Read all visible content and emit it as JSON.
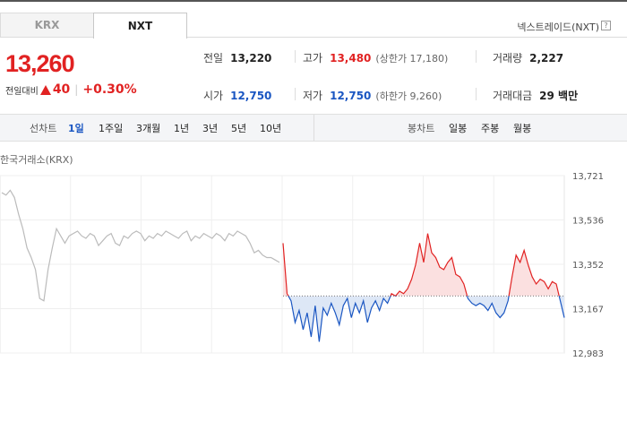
{
  "tabs": [
    {
      "label": "KRX",
      "active": false
    },
    {
      "label": "NXT",
      "active": true
    }
  ],
  "exchange_label": "넥스트레이드(NXT)",
  "help_icon": "?",
  "price": {
    "current": "13,260",
    "change_label": "전일대비",
    "change_value": "40",
    "change_percent": "+0.30%",
    "direction": "up"
  },
  "stats": {
    "prev_close": {
      "label": "전일",
      "value": "13,220"
    },
    "high": {
      "label": "고가",
      "value": "13,480",
      "note": "(상한가 17,180)"
    },
    "volume": {
      "label": "거래량",
      "value": "2,227"
    },
    "open": {
      "label": "시가",
      "value": "12,750"
    },
    "low": {
      "label": "저가",
      "value": "12,750",
      "note": "(하한가 9,260)"
    },
    "trade_value": {
      "label": "거래대금",
      "value": "29 백만"
    }
  },
  "period_bar": {
    "line_label": "선차트",
    "line_periods": [
      "1일",
      "1주일",
      "3개월",
      "1년",
      "3년",
      "5년",
      "10년"
    ],
    "active_period": "1일",
    "candle_label": "봉차트",
    "candle_periods": [
      "일봉",
      "주봉",
      "월봉"
    ]
  },
  "chart_label": "한국거래소(KRX)",
  "colors": {
    "up": "#e12222",
    "down": "#1a56c2",
    "base_grey": "#bbbbbb"
  },
  "chart_data": {
    "type": "line",
    "y_ticks": [
      "13,721",
      "13,536",
      "13,352",
      "13,167",
      "12,983"
    ],
    "ylim": [
      12983,
      13721
    ],
    "baseline": 13220,
    "krx_series": [
      13650,
      13640,
      13660,
      13630,
      13560,
      13500,
      13420,
      13380,
      13330,
      13210,
      13200,
      13330,
      13420,
      13500,
      13470,
      13440,
      13470,
      13480,
      13490,
      13470,
      13460,
      13480,
      13470,
      13430,
      13450,
      13470,
      13480,
      13440,
      13430,
      13470,
      13460,
      13480,
      13490,
      13480,
      13450,
      13470,
      13460,
      13480,
      13470,
      13490,
      13480,
      13470,
      13460,
      13480,
      13490,
      13450,
      13470,
      13460,
      13480,
      13470,
      13460,
      13480,
      13470,
      13450,
      13480,
      13470,
      13490,
      13480,
      13470,
      13440,
      13400,
      13410,
      13390,
      13380,
      13380,
      13370,
      13360
    ],
    "nxt_series": [
      13440,
      13230,
      13200,
      13110,
      13160,
      13080,
      13150,
      13050,
      13180,
      13030,
      13170,
      13140,
      13190,
      13150,
      13100,
      13180,
      13210,
      13130,
      13190,
      13150,
      13200,
      13110,
      13170,
      13200,
      13160,
      13210,
      13190,
      13230,
      13220,
      13240,
      13230,
      13250,
      13290,
      13350,
      13440,
      13360,
      13480,
      13400,
      13380,
      13340,
      13330,
      13360,
      13380,
      13310,
      13300,
      13270,
      13210,
      13190,
      13180,
      13190,
      13180,
      13160,
      13190,
      13150,
      13130,
      13150,
      13200,
      13300,
      13390,
      13360,
      13410,
      13350,
      13300,
      13270,
      13290,
      13280,
      13250,
      13280,
      13270,
      13200,
      13130
    ]
  }
}
